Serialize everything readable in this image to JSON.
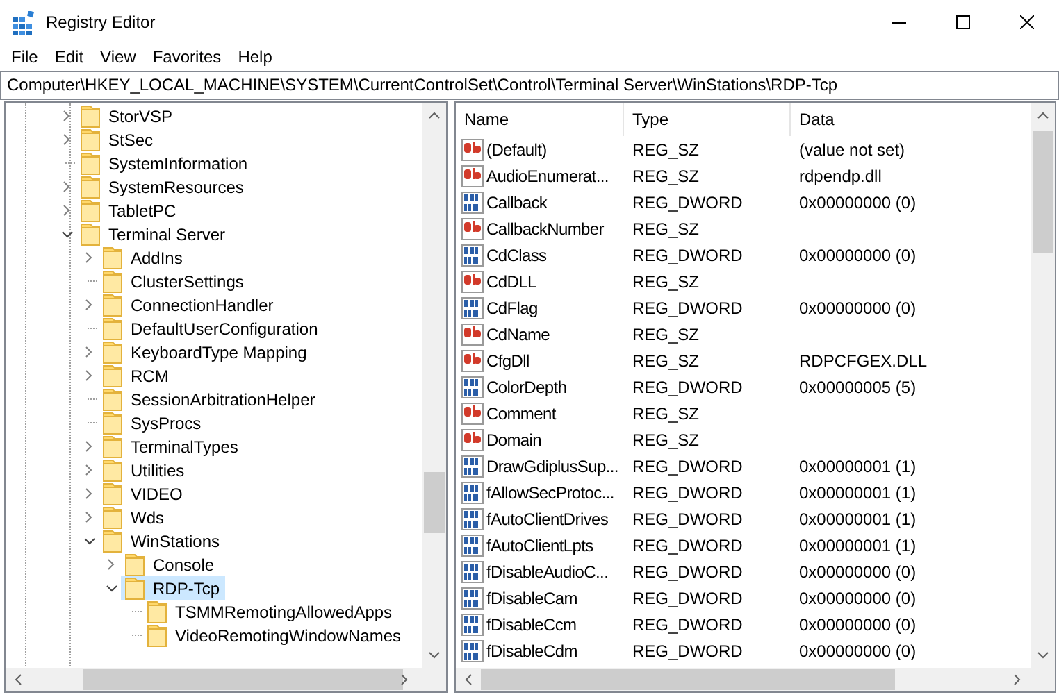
{
  "window": {
    "title": "Registry Editor"
  },
  "menu": [
    "File",
    "Edit",
    "View",
    "Favorites",
    "Help"
  ],
  "address": "Computer\\HKEY_LOCAL_MACHINE\\SYSTEM\\CurrentControlSet\\Control\\Terminal Server\\WinStations\\RDP-Tcp",
  "tree": [
    {
      "label": "StorVSP",
      "kind": "collapsed",
      "selected": false
    },
    {
      "label": "StSec",
      "kind": "collapsed",
      "selected": false
    },
    {
      "label": "SystemInformation",
      "kind": "leaf",
      "selected": false
    },
    {
      "label": "SystemResources",
      "kind": "collapsed",
      "selected": false
    },
    {
      "label": "TabletPC",
      "kind": "collapsed",
      "selected": false
    },
    {
      "label": "Terminal Server",
      "kind": "expanded",
      "selected": false,
      "children": [
        {
          "label": "AddIns",
          "kind": "collapsed",
          "selected": false
        },
        {
          "label": "ClusterSettings",
          "kind": "leaf",
          "selected": false
        },
        {
          "label": "ConnectionHandler",
          "kind": "collapsed",
          "selected": false
        },
        {
          "label": "DefaultUserConfiguration",
          "kind": "leaf",
          "selected": false
        },
        {
          "label": "KeyboardType Mapping",
          "kind": "collapsed",
          "selected": false
        },
        {
          "label": "RCM",
          "kind": "collapsed",
          "selected": false
        },
        {
          "label": "SessionArbitrationHelper",
          "kind": "leaf",
          "selected": false
        },
        {
          "label": "SysProcs",
          "kind": "leaf",
          "selected": false
        },
        {
          "label": "TerminalTypes",
          "kind": "collapsed",
          "selected": false
        },
        {
          "label": "Utilities",
          "kind": "collapsed",
          "selected": false
        },
        {
          "label": "VIDEO",
          "kind": "collapsed",
          "selected": false
        },
        {
          "label": "Wds",
          "kind": "collapsed",
          "selected": false
        },
        {
          "label": "WinStations",
          "kind": "expanded",
          "selected": false,
          "children": [
            {
              "label": "Console",
              "kind": "collapsed",
              "selected": false
            },
            {
              "label": "RDP-Tcp",
              "kind": "expanded",
              "selected": true,
              "children": [
                {
                  "label": "TSMMRemotingAllowedApps",
                  "kind": "leaf",
                  "selected": false
                },
                {
                  "label": "VideoRemotingWindowNames",
                  "kind": "leaf",
                  "selected": false
                }
              ]
            }
          ]
        }
      ]
    }
  ],
  "values": {
    "columns": [
      "Name",
      "Type",
      "Data"
    ],
    "rows": [
      {
        "kind": "string",
        "name": "(Default)",
        "type": "REG_SZ",
        "data": "(value not set)"
      },
      {
        "kind": "string",
        "name": "AudioEnumerat...",
        "type": "REG_SZ",
        "data": "rdpendp.dll"
      },
      {
        "kind": "dword",
        "name": "Callback",
        "type": "REG_DWORD",
        "data": "0x00000000 (0)"
      },
      {
        "kind": "string",
        "name": "CallbackNumber",
        "type": "REG_SZ"
      },
      {
        "kind": "dword",
        "name": "CdClass",
        "type": "REG_DWORD",
        "data": "0x00000000 (0)"
      },
      {
        "kind": "string",
        "name": "CdDLL",
        "type": "REG_SZ"
      },
      {
        "kind": "dword",
        "name": "CdFlag",
        "type": "REG_DWORD",
        "data": "0x00000000 (0)"
      },
      {
        "kind": "string",
        "name": "CdName",
        "type": "REG_SZ"
      },
      {
        "kind": "string",
        "name": "CfgDll",
        "type": "REG_SZ",
        "data": "RDPCFGEX.DLL"
      },
      {
        "kind": "dword",
        "name": "ColorDepth",
        "type": "REG_DWORD",
        "data": "0x00000005 (5)"
      },
      {
        "kind": "string",
        "name": "Comment",
        "type": "REG_SZ"
      },
      {
        "kind": "string",
        "name": "Domain",
        "type": "REG_SZ"
      },
      {
        "kind": "dword",
        "name": "DrawGdiplusSup...",
        "type": "REG_DWORD",
        "data": "0x00000001 (1)"
      },
      {
        "kind": "dword",
        "name": "fAllowSecProtoc...",
        "type": "REG_DWORD",
        "data": "0x00000001 (1)"
      },
      {
        "kind": "dword",
        "name": "fAutoClientDrives",
        "type": "REG_DWORD",
        "data": "0x00000001 (1)"
      },
      {
        "kind": "dword",
        "name": "fAutoClientLpts",
        "type": "REG_DWORD",
        "data": "0x00000001 (1)"
      },
      {
        "kind": "dword",
        "name": "fDisableAudioC...",
        "type": "REG_DWORD",
        "data": "0x00000000 (0)"
      },
      {
        "kind": "dword",
        "name": "fDisableCam",
        "type": "REG_DWORD",
        "data": "0x00000000 (0)"
      },
      {
        "kind": "dword",
        "name": "fDisableCcm",
        "type": "REG_DWORD",
        "data": "0x00000000 (0)"
      },
      {
        "kind": "dword",
        "name": "fDisableCdm",
        "type": "REG_DWORD",
        "data": "0x00000000 (0)"
      }
    ]
  }
}
